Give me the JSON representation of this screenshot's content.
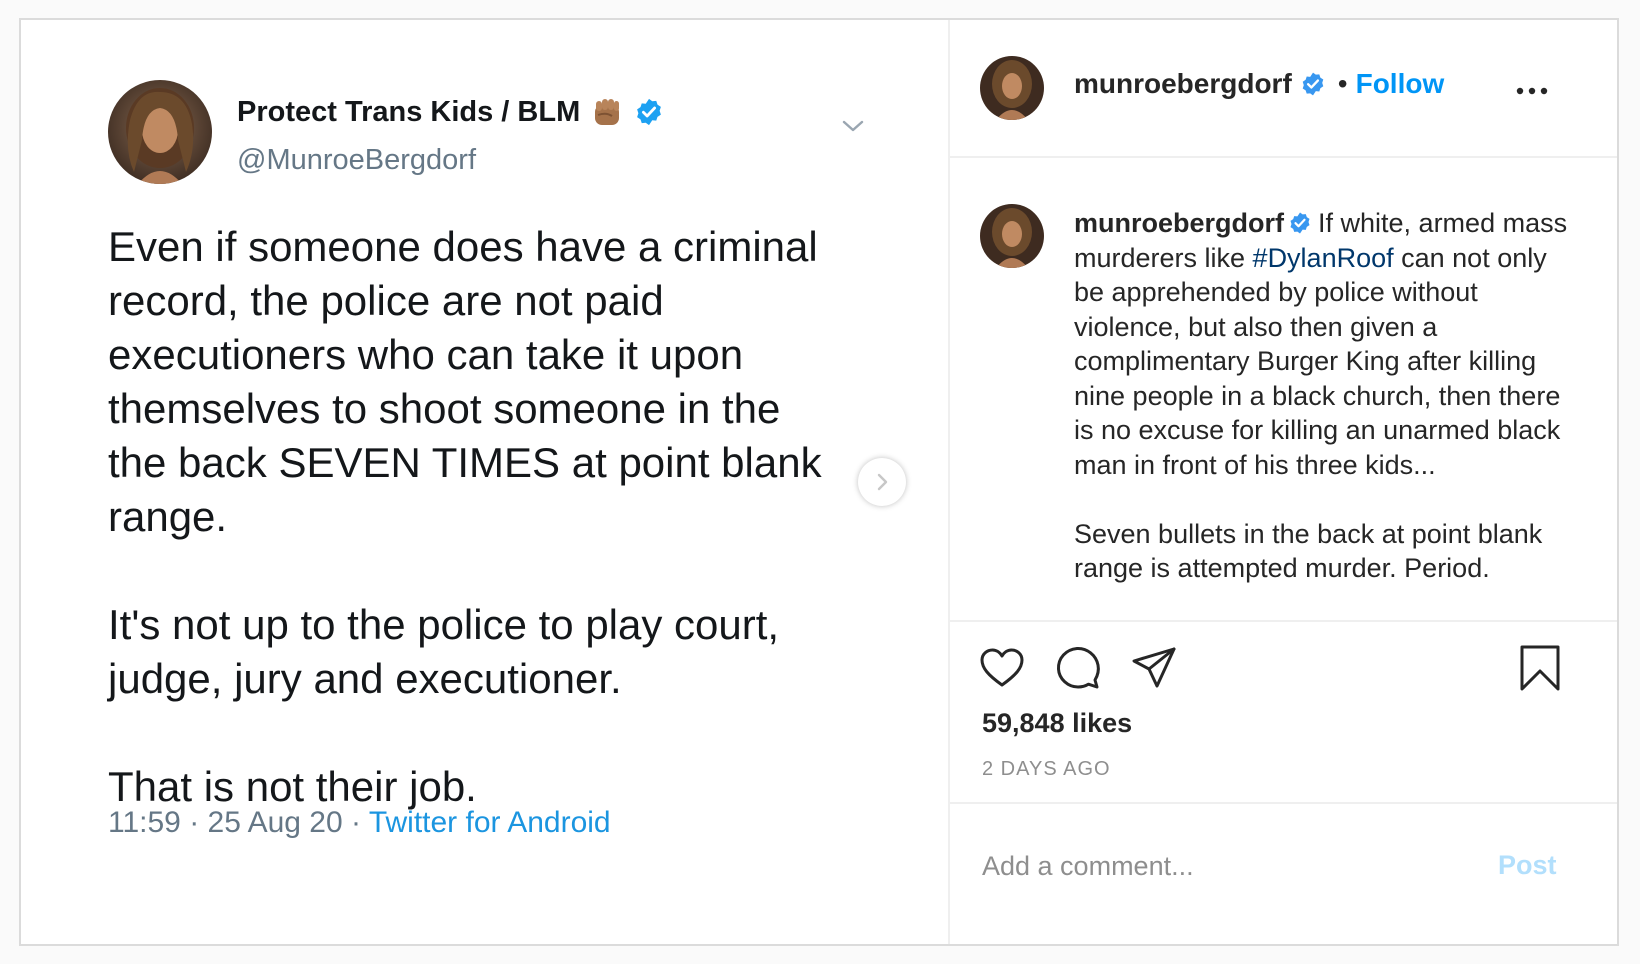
{
  "tweet": {
    "display_name": "Protect Trans Kids / BLM",
    "handle": "@MunroeBergdorf",
    "paragraphs": [
      "Even if someone does have a criminal\nrecord, the police are not paid\nexecutioners who can take it upon\nthemselves to shoot someone in the\nthe back SEVEN TIMES at point blank\nrange.",
      "It's not up to the police to play court,\njudge, jury and executioner.",
      "That is not their job."
    ],
    "time": "11:59",
    "separator": "·",
    "date": "25 Aug 20",
    "source": "Twitter for Android",
    "icons": {
      "fist": "raised-fist-medium-skin-icon",
      "verified": "verified-badge-icon",
      "caret": "chevron-down-icon"
    }
  },
  "carousel": {
    "next_icon": "chevron-right-icon"
  },
  "post": {
    "username": "munroebergdorf",
    "follow_separator": "•",
    "follow_label": "Follow",
    "more_icon": "more-horizontal-icon",
    "caption_user": "munroebergdorf",
    "caption_before_tag": "If white, armed mass murderers like ",
    "caption_tag": "#DylanRoof",
    "caption_after_tag": " can not only be apprehended by police without violence, but also then given a complimentary Burger King after killing nine people in a black church, then there is no excuse for killing an unarmed black man in front of his three kids...",
    "caption_second": "Seven bullets in the back at point blank range is attempted murder. Period.",
    "likes": "59,848 likes",
    "time_ago": "2 DAYS AGO",
    "comment_placeholder": "Add a comment...",
    "post_label": "Post",
    "action_icons": [
      "heart-icon",
      "comment-icon",
      "share-icon",
      "bookmark-icon"
    ]
  },
  "colors": {
    "ig_blue": "#0095f6",
    "tw_blue": "#1b95e0",
    "post_disabled": "#b2dffc",
    "hashtag": "#00376b"
  }
}
